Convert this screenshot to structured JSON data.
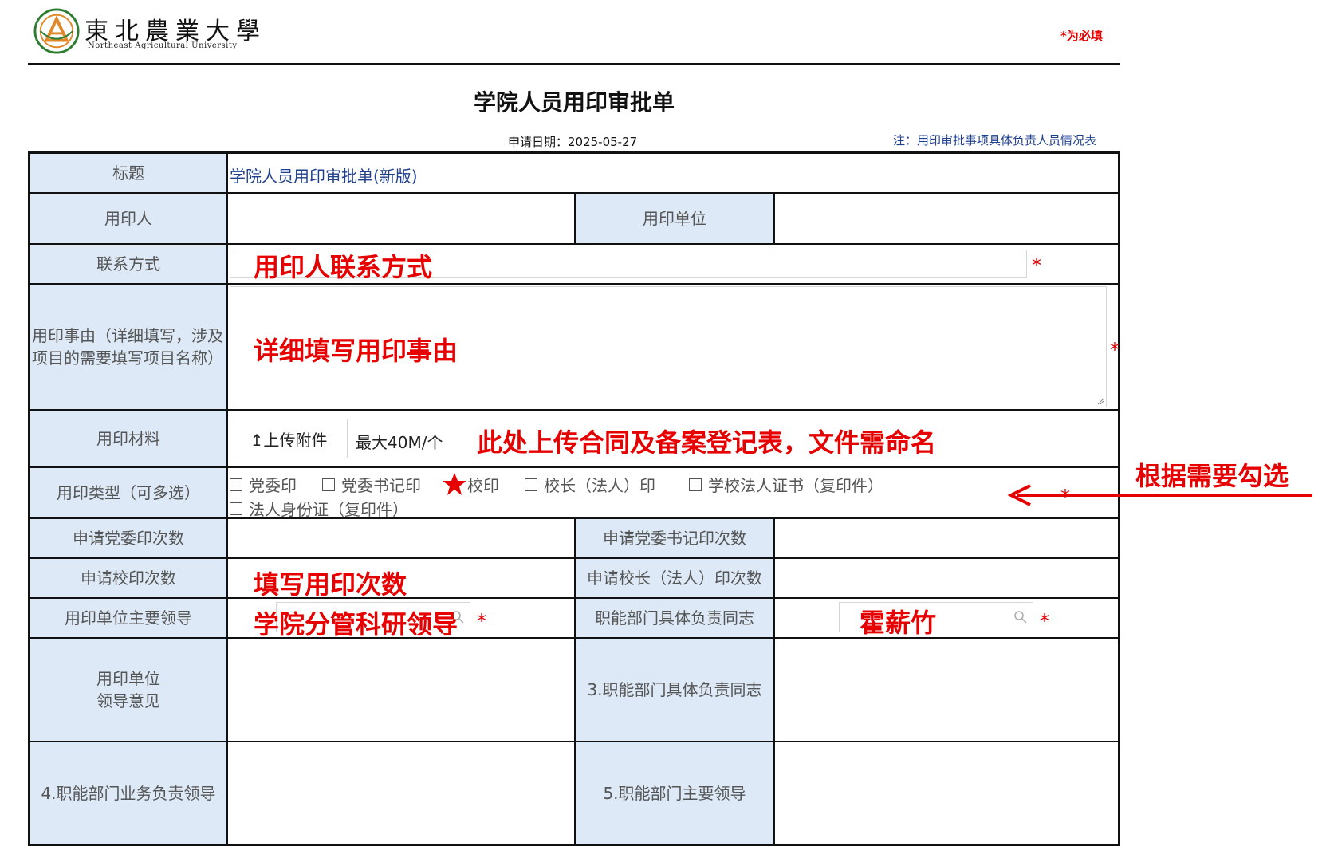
{
  "header": {
    "logo_cn": "東北農業大學",
    "logo_en": "Northeast Agricultural University",
    "required_note": "*为必填"
  },
  "form": {
    "title": "学院人员用印审批单",
    "apply_date": "申请日期：2025-05-27",
    "note_link": "注：用印审批事项具体负责人员情况表"
  },
  "rows": {
    "title_label": "标题",
    "title_value": "学院人员用印审批单(新版)",
    "applicant_label": "用印人",
    "unit_label": "用印单位",
    "contact_label": "联系方式",
    "reason_label": "用印事由（详细填写，涉及项目的需要填写项目名称）",
    "material_label": "用印材料",
    "upload_button": "↥上传附件",
    "upload_hint": "最大40M/个",
    "seal_type_label": "用印类型（可多选）",
    "seal_options": [
      "党委印",
      "党委书记印",
      "校印",
      "校长（法人）印",
      "学校法人证书（复印件）",
      "法人身份证（复印件）"
    ],
    "party_seal_count_label": "申请党委印次数",
    "secretary_seal_count_label": "申请党委书记印次数",
    "school_seal_count_label": "申请校印次数",
    "president_seal_count_label": "申请校长（法人）印次数",
    "unit_leader_label": "用印单位主要领导",
    "dept_person_label": "职能部门具体负责同志",
    "unit_opinion_label": "用印单位领导意见",
    "dept_person_opinion_label": "3.职能部门具体负责同志",
    "dept_business_leader_label": "4.职能部门业务负责领导",
    "dept_main_leader_label": "5.职能部门主要领导"
  },
  "annotations": {
    "contact": "用印人联系方式",
    "reason": "详细填写用印事由",
    "material": "此处上传合同及备案登记表，文件需命名",
    "seal_type": "根据需要勾选",
    "count": "填写用印次数",
    "unit_leader": "学院分管科研领导",
    "dept_person": "霍薪竹"
  },
  "colors": {
    "label_bg": "#dde9f6",
    "annotation": "#e60000",
    "link": "#1f3f8f"
  }
}
